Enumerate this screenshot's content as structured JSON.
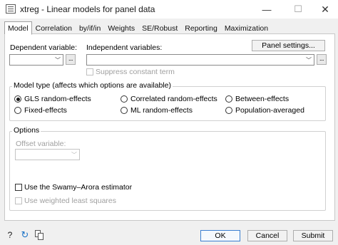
{
  "window": {
    "title": "xtreg - Linear models for panel data",
    "minimize": "—",
    "maximize": "☐",
    "close": "✕"
  },
  "tabs": [
    {
      "label": "Model",
      "active": true
    },
    {
      "label": "Correlation"
    },
    {
      "label": "by/if/in"
    },
    {
      "label": "Weights"
    },
    {
      "label": "SE/Robust"
    },
    {
      "label": "Reporting"
    },
    {
      "label": "Maximization"
    }
  ],
  "model": {
    "dependent_label": "Dependent variable:",
    "dependent_value": "",
    "independent_label": "Independent variables:",
    "independent_value": "",
    "panel_settings_label": "Panel settings...",
    "suppress_constant_label": "Suppress constant term",
    "dots_label": "...",
    "combo_arrow": "﹀"
  },
  "model_type": {
    "title": "Model type (affects which options are available)",
    "options": [
      {
        "label": "GLS random-effects",
        "checked": true
      },
      {
        "label": "Correlated random-effects",
        "checked": false
      },
      {
        "label": "Between-effects",
        "checked": false
      },
      {
        "label": "Fixed-effects",
        "checked": false
      },
      {
        "label": "ML random-effects",
        "checked": false
      },
      {
        "label": "Population-averaged",
        "checked": false
      }
    ]
  },
  "options": {
    "title": "Options",
    "offset_label": "Offset variable:",
    "offset_value": "",
    "swamy_label": "Use the Swamy–Arora estimator",
    "wls_label": "Use weighted least squares"
  },
  "footer": {
    "help_icon": "?",
    "refresh_icon": "↻",
    "ok_label": "OK",
    "cancel_label": "Cancel",
    "submit_label": "Submit"
  }
}
